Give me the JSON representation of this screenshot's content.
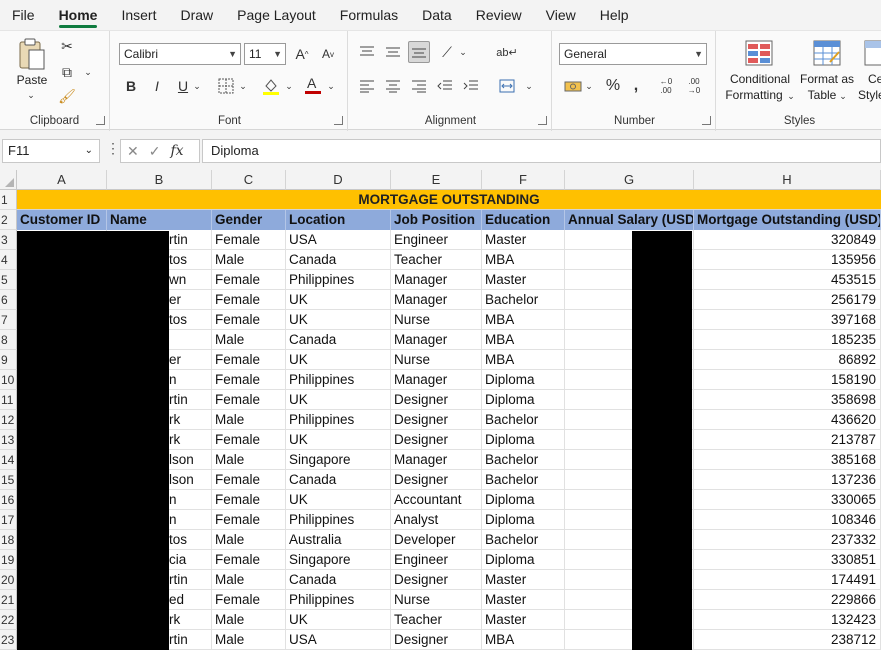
{
  "menu": [
    "File",
    "Home",
    "Insert",
    "Draw",
    "Page Layout",
    "Formulas",
    "Data",
    "Review",
    "View",
    "Help"
  ],
  "menu_active": "Home",
  "ribbon": {
    "clipboard": {
      "label": "Clipboard",
      "paste": "Paste"
    },
    "font": {
      "label": "Font",
      "font_name": "Calibri",
      "font_size": "11"
    },
    "alignment": {
      "label": "Alignment"
    },
    "number": {
      "label": "Number",
      "format": "General"
    },
    "styles": {
      "label": "Styles",
      "conditional_line1": "Conditional",
      "conditional_line2": "Formatting",
      "format_table_line1": "Format as",
      "format_table_line2": "Table",
      "cell_styles_line1": "Ce",
      "cell_styles_line2": "Style"
    }
  },
  "formula_bar": {
    "name_box": "F11",
    "content": "Diploma",
    "fx": "fx"
  },
  "columns": [
    "A",
    "B",
    "C",
    "D",
    "E",
    "F",
    "G",
    "H"
  ],
  "title": "MORTGAGE OUTSTANDING",
  "headers": [
    "Customer ID",
    "Name",
    "Gender",
    "Location",
    "Job Position",
    "Education",
    "Annual Salary (USD)",
    "Mortgage Outstanding (USD)"
  ],
  "rows": [
    {
      "n": "3",
      "name": "rtin",
      "gender": "Female",
      "location": "USA",
      "job": "Engineer",
      "edu": "Master",
      "mortgage": "320849"
    },
    {
      "n": "4",
      "name": "tos",
      "gender": "Male",
      "location": "Canada",
      "job": "Teacher",
      "edu": "MBA",
      "mortgage": "135956"
    },
    {
      "n": "5",
      "name": "wn",
      "gender": "Female",
      "location": "Philippines",
      "job": "Manager",
      "edu": "Master",
      "mortgage": "453515"
    },
    {
      "n": "6",
      "name": "er",
      "gender": "Female",
      "location": "UK",
      "job": "Manager",
      "edu": "Bachelor",
      "mortgage": "256179"
    },
    {
      "n": "7",
      "name": "tos",
      "gender": "Female",
      "location": "UK",
      "job": "Nurse",
      "edu": "MBA",
      "mortgage": "397168"
    },
    {
      "n": "8",
      "name": "",
      "gender": "Male",
      "location": "Canada",
      "job": "Manager",
      "edu": "MBA",
      "mortgage": "185235"
    },
    {
      "n": "9",
      "name": "er",
      "gender": "Female",
      "location": "UK",
      "job": "Nurse",
      "edu": "MBA",
      "mortgage": "86892"
    },
    {
      "n": "10",
      "name": "n",
      "gender": "Female",
      "location": "Philippines",
      "job": "Manager",
      "edu": "Diploma",
      "mortgage": "158190"
    },
    {
      "n": "11",
      "name": "rtin",
      "gender": "Female",
      "location": "UK",
      "job": "Designer",
      "edu": "Diploma",
      "mortgage": "358698"
    },
    {
      "n": "12",
      "name": "rk",
      "gender": "Male",
      "location": "Philippines",
      "job": "Designer",
      "edu": "Bachelor",
      "mortgage": "436620"
    },
    {
      "n": "13",
      "name": "rk",
      "gender": "Female",
      "location": "UK",
      "job": "Designer",
      "edu": "Diploma",
      "mortgage": "213787"
    },
    {
      "n": "14",
      "name": "lson",
      "gender": "Male",
      "location": "Singapore",
      "job": "Manager",
      "edu": "Bachelor",
      "mortgage": "385168"
    },
    {
      "n": "15",
      "name": "lson",
      "gender": "Female",
      "location": "Canada",
      "job": "Designer",
      "edu": "Bachelor",
      "mortgage": "137236"
    },
    {
      "n": "16",
      "name": "n",
      "gender": "Female",
      "location": "UK",
      "job": "Accountant",
      "edu": "Diploma",
      "mortgage": "330065"
    },
    {
      "n": "17",
      "name": "n",
      "gender": "Female",
      "location": "Philippines",
      "job": "Analyst",
      "edu": "Diploma",
      "mortgage": "108346"
    },
    {
      "n": "18",
      "name": "tos",
      "gender": "Male",
      "location": "Australia",
      "job": "Developer",
      "edu": "Bachelor",
      "mortgage": "237332"
    },
    {
      "n": "19",
      "name": "cia",
      "gender": "Female",
      "location": "Singapore",
      "job": "Engineer",
      "edu": "Diploma",
      "mortgage": "330851"
    },
    {
      "n": "20",
      "name": "rtin",
      "gender": "Male",
      "location": "Canada",
      "job": "Designer",
      "edu": "Master",
      "mortgage": "174491"
    },
    {
      "n": "21",
      "name": "ed",
      "gender": "Female",
      "location": "Philippines",
      "job": "Nurse",
      "edu": "Master",
      "mortgage": "229866"
    },
    {
      "n": "22",
      "name": "rk",
      "gender": "Male",
      "location": "UK",
      "job": "Teacher",
      "edu": "Master",
      "mortgage": "132423"
    },
    {
      "n": "23",
      "name": "rtin",
      "gender": "Male",
      "location": "USA",
      "job": "Designer",
      "edu": "MBA",
      "mortgage": "238712"
    }
  ],
  "colors": {
    "title_fill": "#ffc000",
    "header_fill": "#8eaadb",
    "active_tab": "#0f7b3f"
  }
}
